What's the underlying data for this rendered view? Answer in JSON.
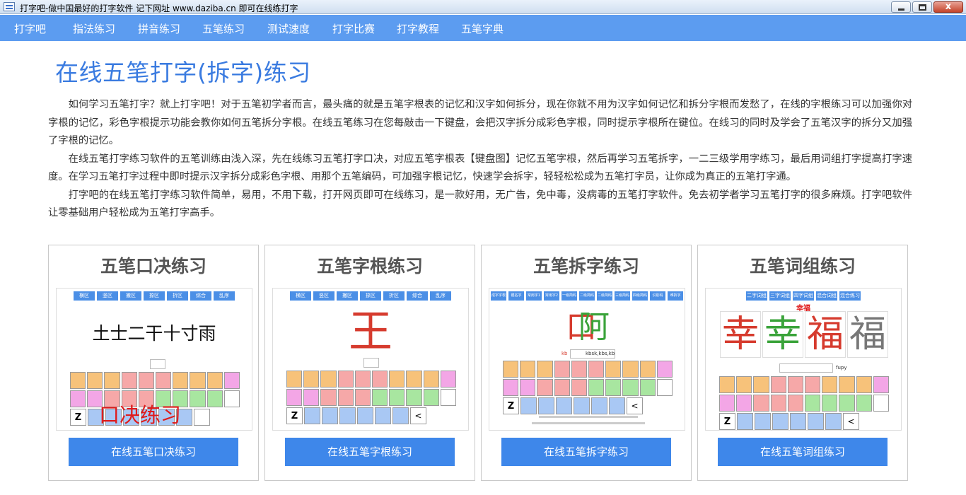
{
  "window": {
    "title": "打字吧-做中国最好的打字软件 记下网址 www.daziba.cn 即可在线练打字",
    "close_label": "x"
  },
  "nav": {
    "items": [
      "打字吧",
      "指法练习",
      "拼音练习",
      "五笔练习",
      "测试速度",
      "打字比赛",
      "打字教程",
      "五笔字典"
    ]
  },
  "page": {
    "title": "在线五笔打字(拆字)练习",
    "paragraphs": [
      "如何学习五笔打字？就上打字吧！对于五笔初学者而言，最头痛的就是五笔字根表的记忆和汉字如何拆分，现在你就不用为汉字如何记忆和拆分字根而发愁了，在线的字根练习可以加强你对字根的记忆，彩色字根提示功能会教你如何五笔拆分字根。在线五笔练习在您每敲击一下键盘，会把汉字拆分成彩色字根，同时提示字根所在键位。在线习的同时及学会了五笔汉字的拆分又加强了字根的记忆。",
      "在线五笔打字练习软件的五笔训练由浅入深，先在线练习五笔打字口决，对应五笔字根表【键盘图】记忆五笔字根，然后再学习五笔拆字，一二三级学用字练习，最后用词组打字提高打字速度。在学习五笔打字过程中即时提示汉字拆分成彩色字根、用那个五笔编码，可加强字根记忆，快速学会拆字，轻轻松松成为五笔打字员，让你成为真正的五笔打字通。",
      "打字吧的在线五笔打字练习软件简单，易用，不用下载，打开网页即可在线练习，是一款好用，无广告，免中毒，没病毒的五笔打字软件。免去初学者学习五笔打字的很多麻烦。打字吧软件让零基础用户轻松成为五笔打字高手。"
    ]
  },
  "cards": [
    {
      "title": "五笔口决练习",
      "button": "在线五笔口决练习",
      "preview": {
        "tabs": [
          "横区",
          "竖区",
          "撇区",
          "捺区",
          "折区",
          "综合",
          "乱序"
        ],
        "text": "土士二干十寸雨",
        "overlay": "口决练习",
        "key_z": "Z"
      }
    },
    {
      "title": "五笔字根练习",
      "button": "在线五笔字根练习",
      "preview": {
        "tabs": [
          "横区",
          "竖区",
          "撇区",
          "捺区",
          "折区",
          "综合",
          "乱序"
        ],
        "char": "王",
        "key_z": "Z",
        "key_lt": "<"
      }
    },
    {
      "title": "五笔拆字练习",
      "button": "在线五笔拆字练习",
      "preview": {
        "tabs": [
          "成字字根",
          "键名字",
          "常用字1",
          "常用字2",
          "一级简码",
          "二级简码",
          "二级简码",
          "三级简码",
          "四级简码",
          "识别码",
          "难拆字"
        ],
        "char_left": "口",
        "char_right": "阿",
        "code_hint": "kb",
        "code_full": "kbsk,kbs,kb",
        "key_z": "Z",
        "key_lt": "<"
      }
    },
    {
      "title": "五笔词组练习",
      "button": "在线五笔词组练习",
      "preview": {
        "tabs": [
          "二字词组",
          "三字词组",
          "四字词组",
          "混合词组",
          "混合练习"
        ],
        "word_label": "幸福",
        "chars": [
          "幸",
          "幸",
          "福",
          "福"
        ],
        "code": "fupy",
        "key_z": "Z",
        "key_lt": "<"
      }
    }
  ],
  "colors": {
    "nav_bg": "#5c9cf0",
    "title_blue": "#3a7be0",
    "button_bg": "#3e87ea",
    "radical_red": "#d63b2e",
    "radical_green": "#3aa33a"
  }
}
